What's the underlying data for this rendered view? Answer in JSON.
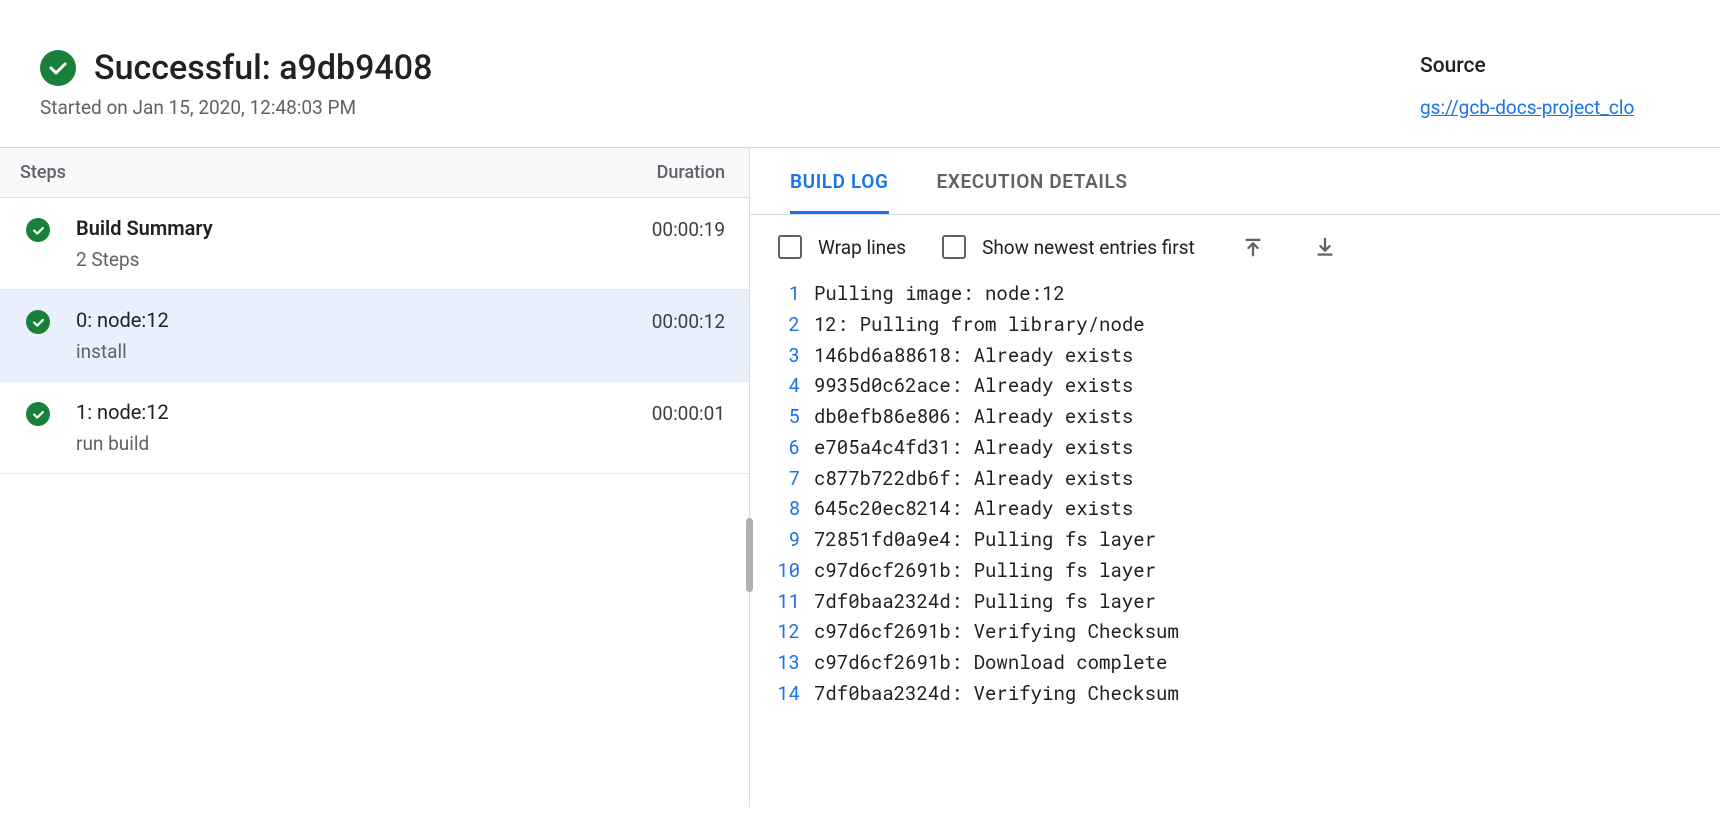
{
  "header": {
    "title": "Successful: a9db9408",
    "subtitle": "Started on Jan 15, 2020, 12:48:03 PM"
  },
  "source": {
    "label": "Source",
    "link": "gs://gcb-docs-project_clo"
  },
  "steps_table": {
    "col_steps": "Steps",
    "col_duration": "Duration"
  },
  "steps": [
    {
      "title": "Build Summary",
      "sub": "2 Steps",
      "duration": "00:00:19",
      "bold": true,
      "selected": false
    },
    {
      "title": "0: node:12",
      "sub": "install",
      "duration": "00:00:12",
      "bold": false,
      "selected": true
    },
    {
      "title": "1: node:12",
      "sub": "run build",
      "duration": "00:00:01",
      "bold": false,
      "selected": false
    }
  ],
  "tabs": {
    "build_log": "BUILD LOG",
    "execution_details": "EXECUTION DETAILS"
  },
  "log_controls": {
    "wrap_lines": "Wrap lines",
    "newest_first": "Show newest entries first"
  },
  "log_lines": [
    "Pulling image: node:12",
    "12: Pulling from library/node",
    "146bd6a88618: Already exists",
    "9935d0c62ace: Already exists",
    "db0efb86e806: Already exists",
    "e705a4c4fd31: Already exists",
    "c877b722db6f: Already exists",
    "645c20ec8214: Already exists",
    "72851fd0a9e4: Pulling fs layer",
    "c97d6cf2691b: Pulling fs layer",
    "7df0baa2324d: Pulling fs layer",
    "c97d6cf2691b: Verifying Checksum",
    "c97d6cf2691b: Download complete",
    "7df0baa2324d: Verifying Checksum"
  ]
}
